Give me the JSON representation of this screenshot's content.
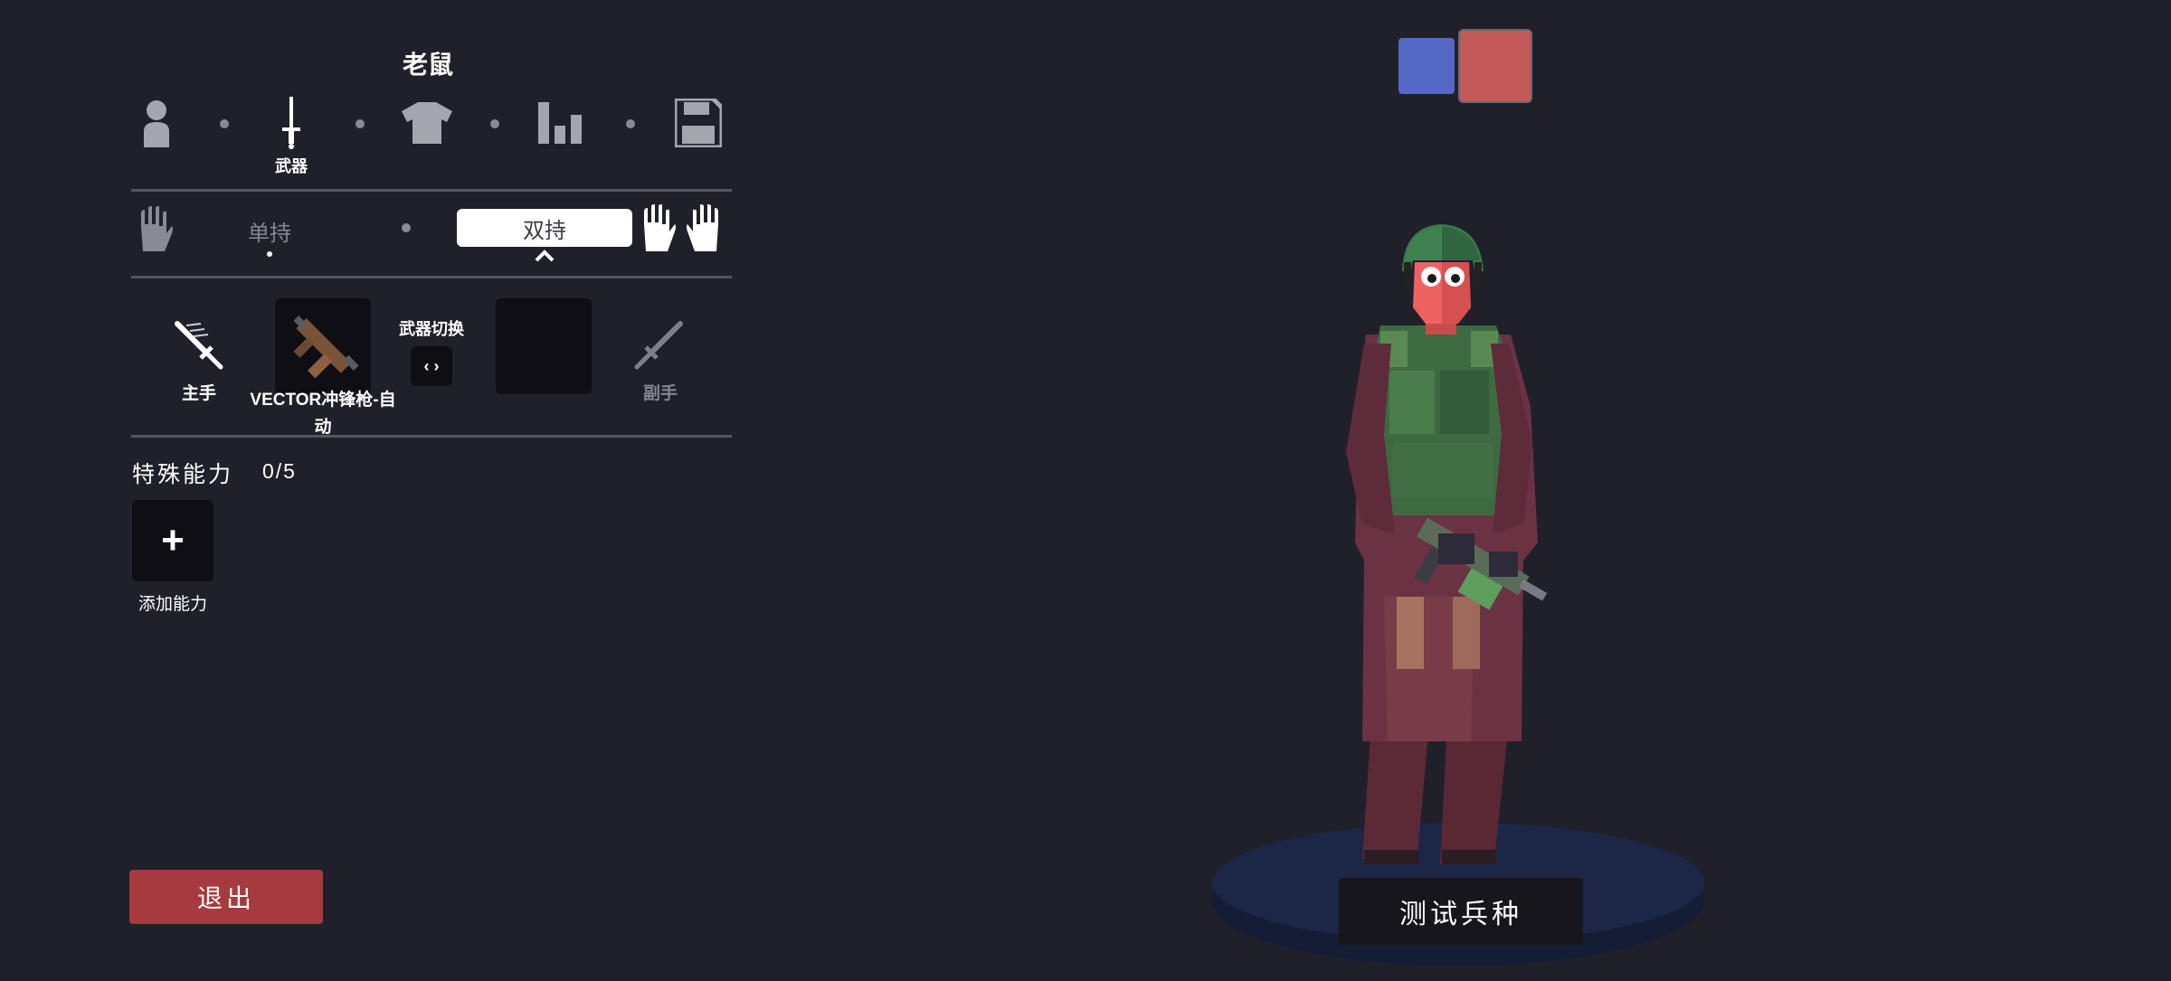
{
  "unit": {
    "name": "老鼠"
  },
  "tabs": [
    {
      "id": "unit",
      "icon": "person-icon",
      "label": ""
    },
    {
      "id": "weapon",
      "icon": "sword-icon",
      "label": "武器"
    },
    {
      "id": "clothing",
      "icon": "shirt-icon",
      "label": ""
    },
    {
      "id": "stats",
      "icon": "bar-chart-icon",
      "label": ""
    },
    {
      "id": "save",
      "icon": "floppy-disk-icon",
      "label": ""
    }
  ],
  "grip": {
    "single_label": "单持",
    "dual_label": "双持",
    "selected": "dual"
  },
  "weapons": {
    "main_hand_label": "主手",
    "main_weapon_name": "VECTOR冲锋枪-自动",
    "swap_label": "武器切换",
    "swap_button": "‹ ›",
    "off_hand_label": "副手"
  },
  "abilities": {
    "title": "特殊能力",
    "count": "0/5",
    "add_symbol": "+",
    "add_label": "添加能力"
  },
  "team_colors": [
    "#5568c4",
    "#c4595a"
  ],
  "exit_label": "退出",
  "test_label": "测试兵种",
  "colors": {
    "background": "#20202b",
    "exit_button": "#a73a3e",
    "pill_bg": "#ffffff"
  }
}
